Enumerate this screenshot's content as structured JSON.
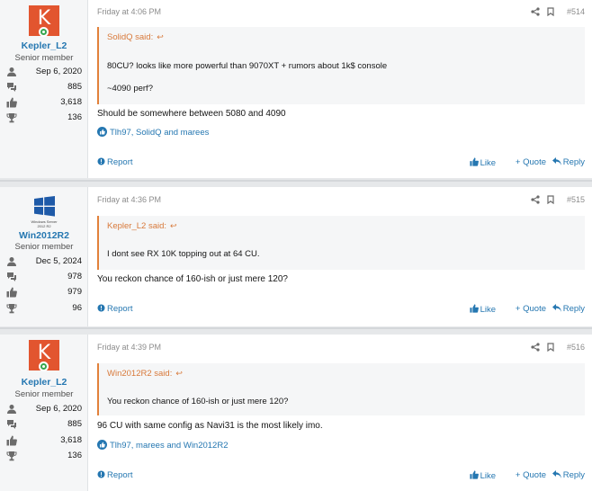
{
  "posts": [
    {
      "user": {
        "name": "Kepler_L2",
        "title": "Senior member",
        "joined": "Sep 6, 2020",
        "messages": "885",
        "reactions": "3,618",
        "points": "136",
        "avatar_letter": "K"
      },
      "time": "Friday at 4:06 PM",
      "number": "#514",
      "quote": {
        "author": "SolidQ said:",
        "lines": [
          "80CU? looks like more powerful than 9070XT + rumors about 1k$ console",
          "~4090 perf?"
        ]
      },
      "message": "Should be somewhere between 5080 and 4090",
      "reactions": "Tlh97, SolidQ and marees"
    },
    {
      "user": {
        "name": "Win2012R2",
        "title": "Senior member",
        "joined": "Dec 5, 2024",
        "messages": "978",
        "reactions": "979",
        "points": "96",
        "avatar_caption": "Windows Server 2012 R2"
      },
      "time": "Friday at 4:36 PM",
      "number": "#515",
      "quote": {
        "author": "Kepler_L2 said:",
        "lines": [
          "I dont see RX 10K topping out at 64 CU."
        ]
      },
      "message": "You reckon chance of 160-ish or just mere 120?",
      "reactions": ""
    },
    {
      "user": {
        "name": "Kepler_L2",
        "title": "Senior member",
        "joined": "Sep 6, 2020",
        "messages": "885",
        "reactions": "3,618",
        "points": "136",
        "avatar_letter": "K"
      },
      "time": "Friday at 4:39 PM",
      "number": "#516",
      "quote": {
        "author": "Win2012R2 said:",
        "lines": [
          "You reckon chance of 160-ish or just mere 120?"
        ]
      },
      "message": "96 CU with same config as Navi31 is the most likely imo.",
      "reactions": "Tlh97, marees and Win2012R2"
    }
  ],
  "labels": {
    "report": "Report",
    "like": "Like",
    "quote": "+ Quote",
    "reply": "Reply",
    "quote_arrow": "↩"
  },
  "colors": {
    "link": "#2577b1",
    "quote_accent": "#e2813a",
    "avatar_bg": "#e2552f",
    "online": "#36a64f"
  },
  "icons": [
    "user-icon",
    "messages-icon",
    "thumbs-up-icon",
    "trophy-icon",
    "share-icon",
    "bookmark-icon",
    "like-reaction-icon",
    "report-icon",
    "reply-icon"
  ]
}
